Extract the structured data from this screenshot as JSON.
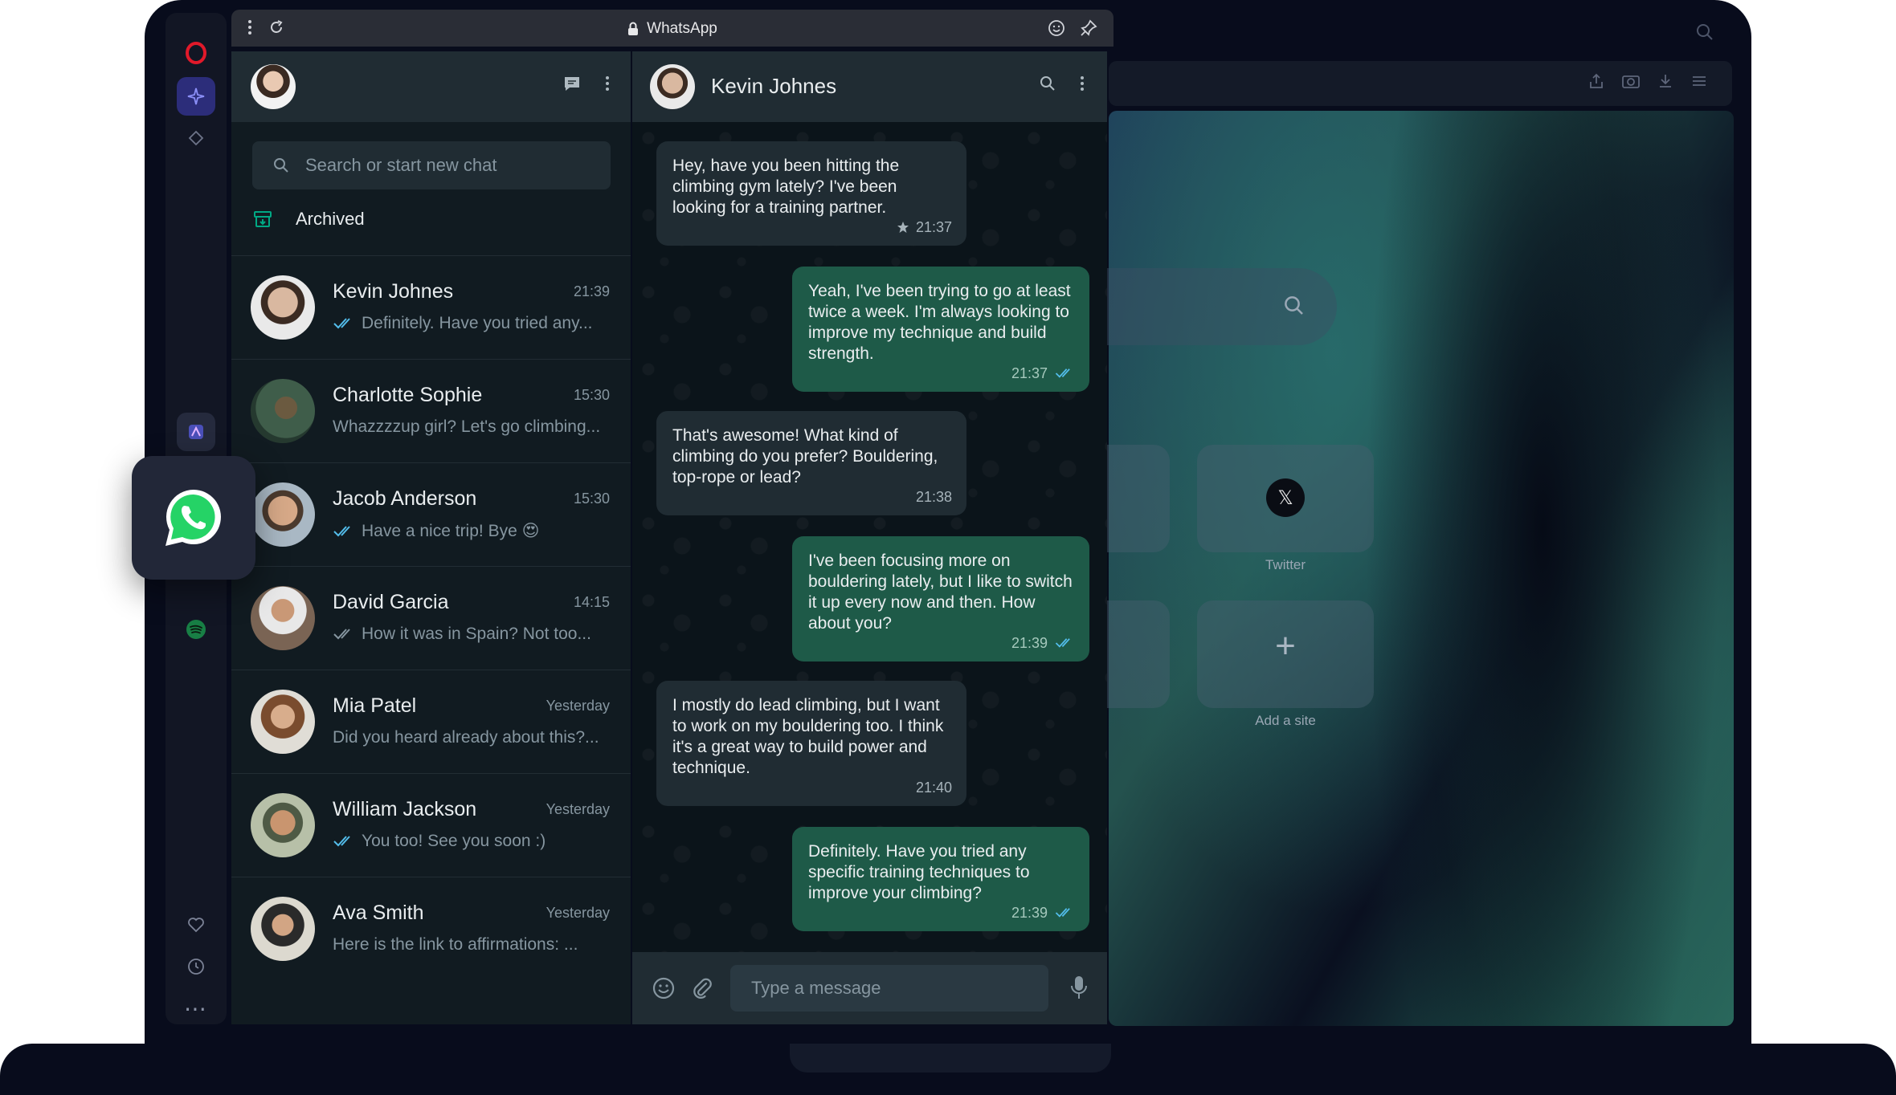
{
  "browser": {
    "tab_title": "WhatsApp",
    "speed_dial": [
      {
        "label": "Twitter",
        "icon": "x-logo-icon"
      },
      {
        "label": "Add a site",
        "icon": "plus-icon"
      }
    ],
    "colors": {
      "accent": "#2c2d7a",
      "opera_red": "#ff1b2d"
    }
  },
  "whatsapp": {
    "search_placeholder": "Search or start new chat",
    "archived_label": "Archived",
    "chats": [
      {
        "name": "Kevin Johnes",
        "time": "21:39",
        "preview": "Definitely. Have you tried any...",
        "ticks": true
      },
      {
        "name": "Charlotte Sophie",
        "time": "15:30",
        "preview": "Whazzzzup girl? Let's go climbing...",
        "ticks": false
      },
      {
        "name": "Jacob Anderson",
        "time": "15:30",
        "preview": "Have a nice trip! Bye 😍",
        "ticks": true
      },
      {
        "name": "David Garcia",
        "time": "14:15",
        "preview": "How it was in Spain? Not too...",
        "ticks": true
      },
      {
        "name": "Mia Patel",
        "time": "Yesterday",
        "preview": "Did you heard already about this?...",
        "ticks": false
      },
      {
        "name": "William Jackson",
        "time": "Yesterday",
        "preview": "You too! See you soon :)",
        "ticks": true
      },
      {
        "name": "Ava Smith",
        "time": "Yesterday",
        "preview": "Here is the link to affirmations: ...",
        "ticks": false
      }
    ],
    "conversation": {
      "contact_name": "Kevin Johnes",
      "messages": [
        {
          "dir": "in",
          "text": "Hey, have you been hitting the climbing gym lately? I've been looking for a training partner.",
          "time": "21:37",
          "starred": true
        },
        {
          "dir": "out",
          "text": "Yeah, I've been trying to go at least twice a week. I'm always looking to improve my technique and build strength.",
          "time": "21:37"
        },
        {
          "dir": "in",
          "text": "That's awesome! What kind of climbing do you prefer? Bouldering, top-rope or lead?",
          "time": "21:38"
        },
        {
          "dir": "out",
          "text": "I've been focusing more on bouldering lately, but I like to switch it up every now and then. How about you?",
          "time": "21:39"
        },
        {
          "dir": "in",
          "text": "I mostly do lead climbing, but I want to work on my bouldering too. I think it's a great way to build power and technique.",
          "time": "21:40"
        },
        {
          "dir": "out",
          "text": "Definitely. Have you tried any specific training techniques to improve your climbing?",
          "time": "21:39"
        }
      ],
      "composer_placeholder": "Type a message"
    },
    "colors": {
      "bg": "#111b21",
      "header": "#202c33",
      "bubble_in": "#202c33",
      "bubble_out": "#1e5a48",
      "brand": "#25d366",
      "tick": "#53bdeb"
    }
  }
}
